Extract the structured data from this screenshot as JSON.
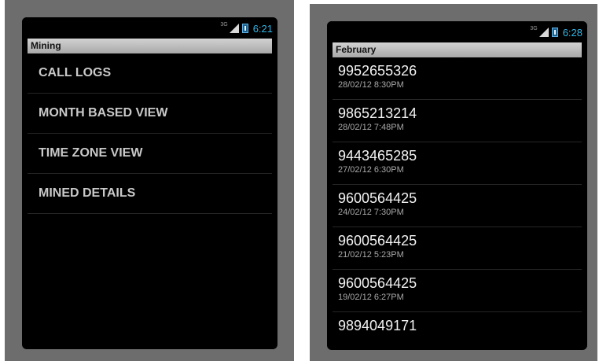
{
  "left_screen": {
    "status": {
      "network": "3G",
      "clock": "6:21"
    },
    "title": "Mining",
    "menu_items": [
      {
        "label": "CALL LOGS"
      },
      {
        "label": "MONTH BASED VIEW"
      },
      {
        "label": "TIME ZONE VIEW"
      },
      {
        "label": "MINED DETAILS"
      }
    ]
  },
  "right_screen": {
    "status": {
      "network": "3G",
      "clock": "6:28"
    },
    "title": "February",
    "calls": [
      {
        "number": "9952655326",
        "time": "28/02/12 8:30PM"
      },
      {
        "number": "9865213214",
        "time": "28/02/12 7:48PM"
      },
      {
        "number": "9443465285",
        "time": "27/02/12 6:30PM"
      },
      {
        "number": "9600564425",
        "time": "24/02/12 7:30PM"
      },
      {
        "number": "9600564425",
        "time": "21/02/12 5:23PM"
      },
      {
        "number": "9600564425",
        "time": "19/02/12 6:27PM"
      },
      {
        "number": "9894049171",
        "time": ""
      }
    ]
  },
  "colors": {
    "accent_clock": "#33b5e5",
    "title_bar": "#bcbcbc",
    "screen_bg": "#000000",
    "frame_bg": "#6d6d6d"
  }
}
